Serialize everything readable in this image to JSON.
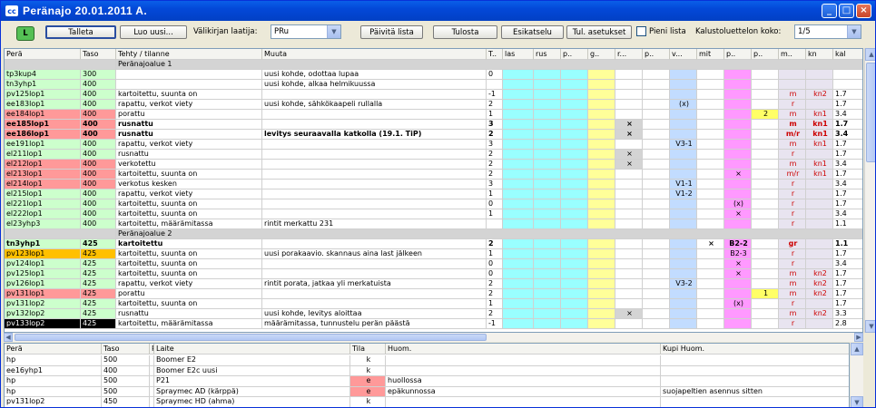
{
  "window": {
    "title": "Peränajo 20.01.2011 A."
  },
  "toolbar": {
    "l_label": "L",
    "talleta": "Talleta",
    "luo_uusi": "Luo uusi...",
    "valikirjan_label": "Välikirjan laatija:",
    "valikirjan_value": "PRu",
    "paivita": "Päivitä lista",
    "tulosta": "Tulosta",
    "esikatselu": "Esikatselu",
    "tul_asetukset": "Tul. asetukset",
    "pieni_lista": "Pieni lista",
    "kalusto_label": "Kalustoluettelon koko:",
    "kalusto_value": "1/5"
  },
  "colors": {
    "green": "#ccffcc",
    "red": "#ff9999",
    "orange": "#ffc000",
    "black": "#000000",
    "cyan": "#99ffff",
    "yellow": "#ffff99",
    "blue": "#c2dcff",
    "pink": "#ff99ff",
    "lilac": "#e8e4f0",
    "gray": "#d4d4d4",
    "darkred": "#cc0000"
  },
  "main_table": {
    "columns": [
      "Perä",
      "Taso",
      "Tehty / tilanne",
      "Muuta",
      "T..",
      "las",
      "rus",
      "p..",
      "g..",
      "r...",
      "p..",
      "v...",
      "mit",
      "p..",
      "p..",
      "m..",
      "kn",
      "kal"
    ],
    "rows": [
      [
        "group",
        "Peränajoalue 1",
        "",
        "",
        "",
        "",
        "",
        "",
        "",
        "",
        "",
        "",
        "",
        "",
        "",
        "",
        "",
        ""
      ],
      [
        "tp3kup4",
        "300",
        "",
        "uusi kohde, odottaa lupaa",
        "0",
        "",
        "",
        "",
        "",
        "",
        "",
        "",
        "",
        "",
        "",
        "",
        "",
        ""
      ],
      [
        "tn3yhp1",
        "400",
        "",
        "uusi kohde, alkaa helmikuussa",
        "",
        "",
        "",
        "",
        "",
        "",
        "",
        "",
        "",
        "",
        "",
        "",
        "",
        ""
      ],
      [
        "pv125lop1",
        "400",
        "kartoitettu, suunta on",
        "",
        "-1",
        "",
        "",
        "",
        "",
        "",
        "",
        "",
        "",
        "",
        "",
        "m",
        "kn2",
        "1.7"
      ],
      [
        "ee183lop1",
        "400",
        "rapattu, verkot viety",
        "uusi kohde, sähkökaapeli rullalla",
        "2",
        "",
        "",
        "",
        "",
        "",
        "",
        "(x)",
        "",
        "",
        "",
        "r",
        "",
        "1.7"
      ],
      [
        "ee184lop1",
        "400",
        "porattu",
        "",
        "1",
        "",
        "",
        "",
        "",
        "",
        "",
        "",
        "",
        "",
        "2",
        "m",
        "kn1",
        "3.4"
      ],
      [
        "ee185lop1",
        "400",
        "rusnattu",
        "",
        "3",
        "",
        "",
        "",
        "",
        "×",
        "",
        "",
        "",
        "",
        "",
        "m",
        "kn1",
        "1.7"
      ],
      [
        "ee186lop1",
        "400",
        "rusnattu",
        "levitys seuraavalla katkolla (19.1. TiP)",
        "2",
        "",
        "",
        "",
        "",
        "×",
        "",
        "",
        "",
        "",
        "",
        "m/r",
        "kn1",
        "3.4"
      ],
      [
        "ee191lop1",
        "400",
        "rapattu, verkot viety",
        "",
        "3",
        "",
        "",
        "",
        "",
        "",
        "",
        "V3-1",
        "",
        "",
        "",
        "m",
        "kn1",
        "1.7"
      ],
      [
        "el211lop1",
        "400",
        "rusnattu",
        "",
        "2",
        "",
        "",
        "",
        "",
        "×",
        "",
        "",
        "",
        "",
        "",
        "r",
        "",
        "1.7"
      ],
      [
        "el212lop1",
        "400",
        "verkotettu",
        "",
        "2",
        "",
        "",
        "",
        "",
        "×",
        "",
        "",
        "",
        "",
        "",
        "m",
        "kn1",
        "3.4"
      ],
      [
        "el213lop1",
        "400",
        "kartoitettu, suunta on",
        "",
        "2",
        "",
        "",
        "",
        "",
        "",
        "",
        "",
        "",
        "×",
        "",
        "m/r",
        "kn1",
        "1.7"
      ],
      [
        "el214lop1",
        "400",
        "verkotus kesken",
        "",
        "3",
        "",
        "",
        "",
        "",
        "",
        "",
        "V1-1",
        "",
        "",
        "",
        "r",
        "",
        "3.4"
      ],
      [
        "el215lop1",
        "400",
        "rapattu, verkot viety",
        "",
        "1",
        "",
        "",
        "",
        "",
        "",
        "",
        "V1-2",
        "",
        "",
        "",
        "r",
        "",
        "1.7"
      ],
      [
        "el221lop1",
        "400",
        "kartoitettu, suunta on",
        "",
        "0",
        "",
        "",
        "",
        "",
        "",
        "",
        "",
        "",
        "(x)",
        "",
        "r",
        "",
        "1.7"
      ],
      [
        "el222lop1",
        "400",
        "kartoitettu, suunta on",
        "",
        "1",
        "",
        "",
        "",
        "",
        "",
        "",
        "",
        "",
        "×",
        "",
        "r",
        "",
        "3.4"
      ],
      [
        "el23yhp3",
        "400",
        "kartoitettu, määrämitassa",
        "rintit merkattu 231",
        "",
        "",
        "",
        "",
        "",
        "",
        "",
        "",
        "",
        "",
        "",
        "r",
        "",
        "1.1"
      ],
      [
        "group",
        "Peränajoalue 2",
        "",
        "",
        "",
        "",
        "",
        "",
        "",
        "",
        "",
        "",
        "",
        "",
        "",
        "",
        "",
        ""
      ],
      [
        "tn3yhp1",
        "425",
        "kartoitettu",
        "",
        "2",
        "",
        "",
        "",
        "",
        "",
        "",
        "",
        "×",
        "B2-2",
        "",
        "gr",
        "",
        "1.1"
      ],
      [
        "pv123lop1",
        "425",
        "kartoitettu, suunta on",
        "uusi porakaavio. skannaus aina last jälkeen",
        "1",
        "",
        "",
        "",
        "",
        "",
        "",
        "",
        "",
        "B2-3",
        "",
        "r",
        "",
        "1.7"
      ],
      [
        "pv124lop1",
        "425",
        "kartoitettu, suunta on",
        "",
        "0",
        "",
        "",
        "",
        "",
        "",
        "",
        "",
        "",
        "×",
        "",
        "r",
        "",
        "3.4"
      ],
      [
        "pv125lop1",
        "425",
        "kartoitettu, suunta on",
        "",
        "0",
        "",
        "",
        "",
        "",
        "",
        "",
        "",
        "",
        "×",
        "",
        "m",
        "kn2",
        "1.7"
      ],
      [
        "pv126lop1",
        "425",
        "rapattu, verkot viety",
        "rintit porata, jatkaa yli merkatuista",
        "2",
        "",
        "",
        "",
        "",
        "",
        "",
        "V3-2",
        "",
        "",
        "",
        "m",
        "kn2",
        "1.7"
      ],
      [
        "pv131lop1",
        "425",
        "porattu",
        "",
        "2",
        "",
        "",
        "",
        "",
        "",
        "",
        "",
        "",
        "",
        "1",
        "m",
        "kn2",
        "1.7"
      ],
      [
        "pv131lop2",
        "425",
        "kartoitettu, suunta on",
        "",
        "1",
        "",
        "",
        "",
        "",
        "",
        "",
        "",
        "",
        "(x)",
        "",
        "r",
        "",
        "1.7"
      ],
      [
        "pv132lop2",
        "425",
        "rusnattu",
        "uusi kohde, levitys aloittaa",
        "2",
        "",
        "",
        "",
        "",
        "×",
        "",
        "",
        "",
        "",
        "",
        "m",
        "kn2",
        "3.3"
      ],
      [
        "pv133lop2",
        "425",
        "kartoitettu, määrämitassa",
        "määrämitassa, tunnustelu perän päästä",
        "-1",
        "",
        "",
        "",
        "",
        "",
        "",
        "",
        "",
        "",
        "",
        "r",
        "",
        "2.8"
      ]
    ]
  },
  "equip_table": {
    "columns": [
      "Perä",
      "Taso",
      "P",
      "Laite",
      "Tila",
      "Huom.",
      "Kupi Huom."
    ],
    "rows": [
      [
        "hp",
        "500",
        "",
        "Boomer E2",
        "k",
        "",
        ""
      ],
      [
        "ee16yhp1",
        "400",
        "",
        "Boomer E2c uusi",
        "k",
        "",
        ""
      ],
      [
        "hp",
        "500",
        "",
        "P21",
        "e",
        "huollossa",
        ""
      ],
      [
        "hp",
        "500",
        "",
        "Spraymec AD (kärppä)",
        "e",
        "epäkunnossa",
        "suojapeltien asennus sitten"
      ],
      [
        "pv131lop2",
        "450",
        "",
        "Spraymec HD (ahma)",
        "k",
        "",
        ""
      ]
    ]
  }
}
